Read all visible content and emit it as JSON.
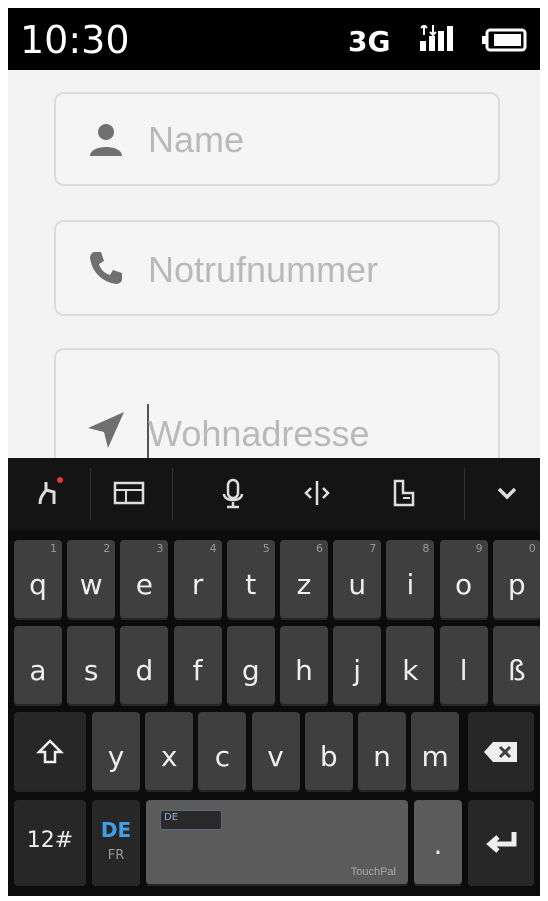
{
  "status_bar": {
    "time": "10:30",
    "network": "3G",
    "signal_icon": "signal-bars-icon",
    "battery_icon": "battery-icon"
  },
  "form": {
    "name": {
      "placeholder": "Name",
      "value": "",
      "icon": "person-icon"
    },
    "emergency_number": {
      "placeholder": "Notrufnummer",
      "value": "",
      "icon": "phone-icon"
    },
    "address": {
      "placeholder": "Wohnadresse",
      "value": "",
      "icon": "location-arrow-icon"
    }
  },
  "keyboard": {
    "toolbar": [
      "swype-icon",
      "layout-icon",
      "microphone-icon",
      "cursor-move-icon",
      "clipboard-icon",
      "collapse-icon"
    ],
    "row1": [
      {
        "label": "q",
        "hint": "1"
      },
      {
        "label": "w",
        "hint": "2"
      },
      {
        "label": "e",
        "hint": "3"
      },
      {
        "label": "r",
        "hint": "4"
      },
      {
        "label": "t",
        "hint": "5"
      },
      {
        "label": "z",
        "hint": "6"
      },
      {
        "label": "u",
        "hint": "7"
      },
      {
        "label": "i",
        "hint": "8"
      },
      {
        "label": "o",
        "hint": "9"
      },
      {
        "label": "p",
        "hint": "0"
      }
    ],
    "row2": [
      "a",
      "s",
      "d",
      "f",
      "g",
      "h",
      "j",
      "k",
      "l",
      "ß"
    ],
    "row3": [
      "y",
      "x",
      "c",
      "v",
      "b",
      "n",
      "m"
    ],
    "numbers_key": "12#",
    "language_key": {
      "primary": "DE",
      "secondary": "FR"
    },
    "space_brand": "TouchPal",
    "period_key": "."
  }
}
